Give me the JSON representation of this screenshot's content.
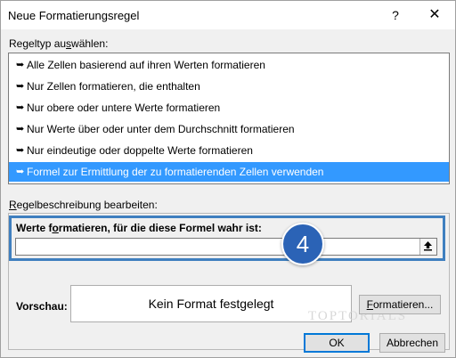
{
  "window": {
    "title": "Neue Formatierungsregel",
    "help_glyph": "?",
    "close_glyph": "✕"
  },
  "rule_type": {
    "label_pre": "Regeltyp au",
    "label_key": "s",
    "label_post": "wählen:",
    "bullet": "➥",
    "items": [
      {
        "label": "Alle Zellen basierend auf ihren Werten formatieren"
      },
      {
        "label": "Nur Zellen formatieren, die enthalten"
      },
      {
        "label": "Nur obere oder untere Werte formatieren"
      },
      {
        "label": "Nur Werte über oder unter dem Durchschnitt formatieren"
      },
      {
        "label": "Nur eindeutige oder doppelte Werte formatieren"
      },
      {
        "label": "Formel zur Ermittlung der zu formatierenden Zellen verwenden",
        "selected": true
      }
    ]
  },
  "rule_description": {
    "label_key": "R",
    "label_post": "egelbeschreibung bearbeiten:",
    "formula_label_pre": "Werte f",
    "formula_label_key": "o",
    "formula_label_post": "rmatieren, für die diese Formel wahr ist:",
    "formula_value": "",
    "step_badge": "4"
  },
  "preview": {
    "label": "Vorschau:",
    "text": "Kein Format festgelegt",
    "watermark": "TOPTORIALS"
  },
  "buttons": {
    "format_key": "F",
    "format_rest": "ormatieren...",
    "ok": "OK",
    "cancel": "Abbrechen"
  },
  "colors": {
    "selection": "#3399ff",
    "highlight_border": "#3f7fbf",
    "badge": "#2b63b6",
    "default_button_border": "#0078d7"
  }
}
